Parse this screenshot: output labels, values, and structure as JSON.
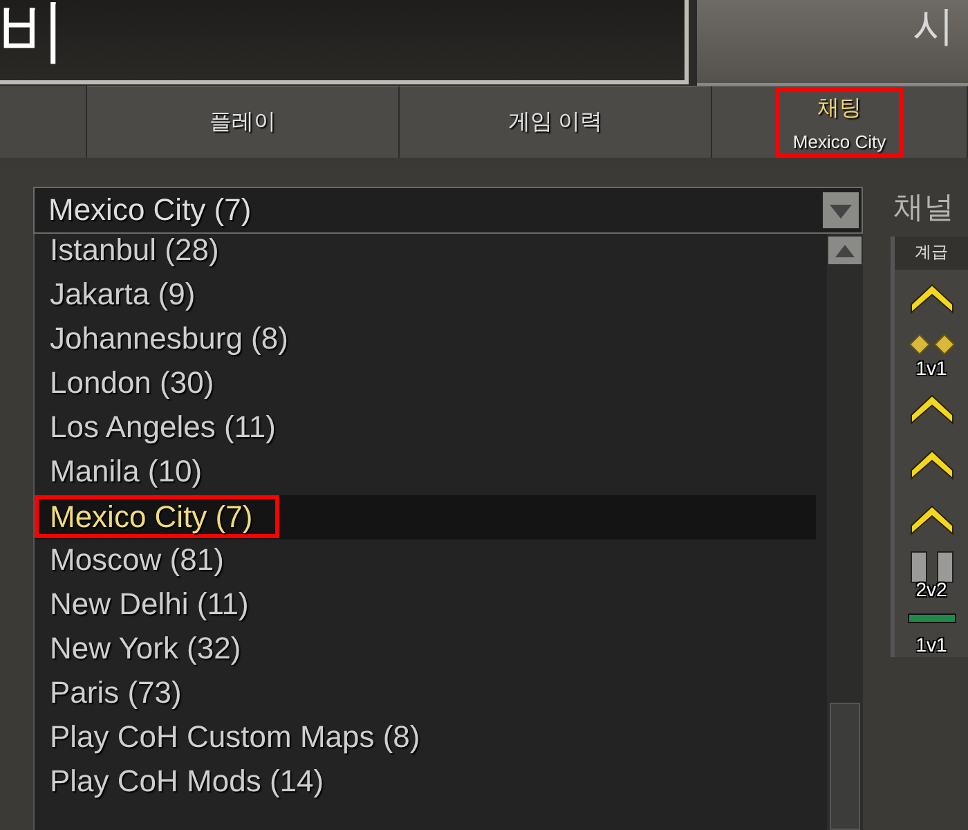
{
  "header": {
    "title": "비",
    "side_title": "시"
  },
  "tabs": [
    {
      "label": "플레이",
      "selected": false,
      "highlighted": false
    },
    {
      "label": "게임 이력",
      "selected": false,
      "highlighted": false
    },
    {
      "label": "채팅",
      "subtitle": "Mexico City",
      "selected": true,
      "highlighted": true
    }
  ],
  "channel_select": {
    "value": "Mexico City (7)"
  },
  "channels": [
    {
      "name": "Istanbul (28)",
      "selected": false,
      "highlighted": false
    },
    {
      "name": "Jakarta (9)",
      "selected": false,
      "highlighted": false
    },
    {
      "name": "Johannesburg (8)",
      "selected": false,
      "highlighted": false
    },
    {
      "name": "London (30)",
      "selected": false,
      "highlighted": false
    },
    {
      "name": "Los Angeles (11)",
      "selected": false,
      "highlighted": false
    },
    {
      "name": "Manila (10)",
      "selected": false,
      "highlighted": false
    },
    {
      "name": "Mexico City (7)",
      "selected": true,
      "highlighted": true
    },
    {
      "name": "Moscow (81)",
      "selected": false,
      "highlighted": false
    },
    {
      "name": "New Delhi (11)",
      "selected": false,
      "highlighted": false
    },
    {
      "name": "New York (32)",
      "selected": false,
      "highlighted": false
    },
    {
      "name": "Paris (73)",
      "selected": false,
      "highlighted": false
    },
    {
      "name": "Play CoH Custom Maps (8)",
      "selected": false,
      "highlighted": false
    },
    {
      "name": "Play CoH Mods (14)",
      "selected": false,
      "highlighted": false
    }
  ],
  "side_panel": {
    "title": "채널",
    "column": "계급",
    "ranks": [
      {
        "kind": "chevron"
      },
      {
        "kind": "diamonds",
        "label": "1v1"
      },
      {
        "kind": "chevron"
      },
      {
        "kind": "chevron"
      },
      {
        "kind": "chevron"
      },
      {
        "kind": "bars",
        "label": "2v2"
      },
      {
        "kind": "stripe",
        "label": "1v1"
      }
    ]
  }
}
